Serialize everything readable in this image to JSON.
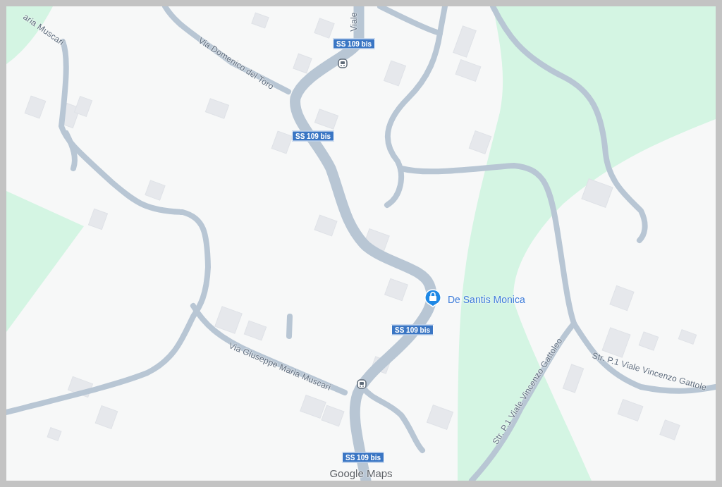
{
  "map": {
    "street_labels": [
      {
        "text": "aria Muscari"
      },
      {
        "text": "Viale"
      },
      {
        "text": "Via Domenico del Toro"
      },
      {
        "text": "Via Giuseppe Maria Muscari"
      },
      {
        "text": "Str. P.1 Viale Vincenzo Gattoleo"
      },
      {
        "text": "Str. P.1 Viale Vincenzo Gattole"
      }
    ],
    "route_shields": [
      "SS 109 bis",
      "SS 109 bis",
      "SS 109 bis",
      "SS 109 bis"
    ],
    "place": {
      "name": "De Santis Monica"
    },
    "attribution": "Google Maps"
  }
}
